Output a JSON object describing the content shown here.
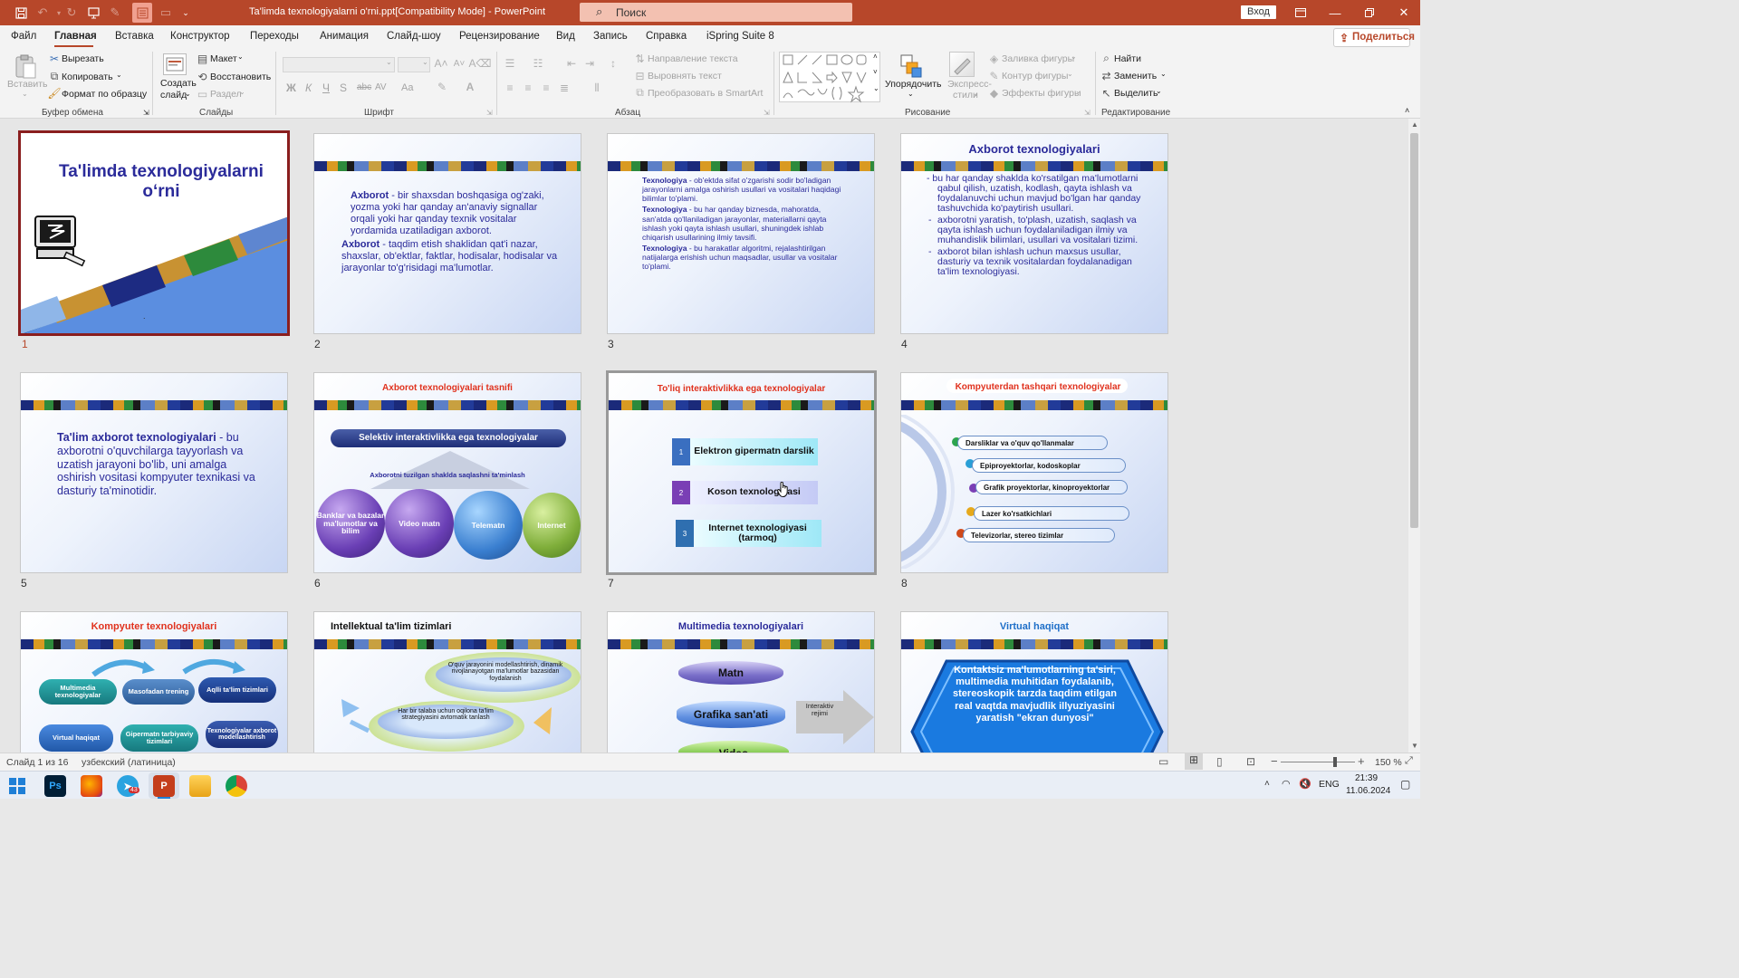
{
  "window": {
    "title": "Ta'limda texnologiyalarni o'rni.ppt[Compatibility Mode]  -  PowerPoint",
    "search_placeholder": "Поиск",
    "signin_label": "Вход"
  },
  "menu": {
    "items": [
      "Файл",
      "Главная",
      "Вставка",
      "Конструктор",
      "Переходы",
      "Анимация",
      "Слайд-шоу",
      "Рецензирование",
      "Вид",
      "Запись",
      "Справка",
      "iSpring Suite 8"
    ],
    "share_label": "Поделиться"
  },
  "ribbon": {
    "clipboard": {
      "paste": "Вставить",
      "cut": "Вырезать",
      "copy": "Копировать",
      "format_painter": "Формат по образцу",
      "group": "Буфер обмена"
    },
    "slides": {
      "new_slide_1": "Создать",
      "new_slide_2": "слайд",
      "layout": "Макет",
      "reset": "Восстановить",
      "section": "Раздел",
      "group": "Слайды"
    },
    "font": {
      "group": "Шрифт",
      "bold": "Ж",
      "italic": "К",
      "underline": "Ч",
      "strike": "S",
      "abc": "abc",
      "spacing": "AV",
      "case": "Aa"
    },
    "paragraph": {
      "text_direction": "Направление текста",
      "align_text": "Выровнять текст",
      "smartart": "Преобразовать в SmartArt",
      "group": "Абзац"
    },
    "drawing": {
      "arrange": "Упорядочить",
      "quick_styles_1": "Экспресс-",
      "quick_styles_2": "стили",
      "shape_fill": "Заливка фигуры",
      "shape_outline": "Контур фигуры",
      "shape_effects": "Эффекты фигуры",
      "group": "Рисование"
    },
    "editing": {
      "find": "Найти",
      "replace": "Заменить",
      "select": "Выделить",
      "group": "Редактирование"
    }
  },
  "slides": {
    "s1": {
      "num": "1",
      "title": "Ta'limda texnologiyalarni o‘rni",
      "dot": "."
    },
    "s2": {
      "num": "2",
      "p1_term": "Axborot",
      "p1": " - bir shaxsdan boshqasiga og'zaki, yozma yoki har qanday an'anaviy signallar orqali yoki har qanday texnik vositalar yordamida uzatiladigan axborot.",
      "p2_term": "Axborot",
      "p2": " - taqdim etish shaklidan qat'i nazar, shaxslar, ob'ektlar, faktlar, hodisalar, hodisalar va jarayonlar to'g'risidagi ma'lumotlar."
    },
    "s3": {
      "num": "3",
      "p1_term": "Texnologiya",
      "p1": " - ob'ektda sifat o'zgarishi sodir bo'ladigan jarayonlarni amalga oshirish usullari va vositalari haqidagi bilimlar to'plami.",
      "p2_term": "Texnologiya",
      "p2": " - bu har qanday biznesda, mahoratda, san'atda qo'llaniladigan jarayonlar, materiallarni qayta ishlash yoki qayta ishlash usullari, shuningdek ishlab chiqarish usullarining ilmiy tavsifi.",
      "p3_term": "Texnologiya",
      "p3": " - bu harakatlar algoritmi, rejalashtirilgan natijalarga erishish uchun maqsadlar, usullar va vositalar to'plami."
    },
    "s4": {
      "num": "4",
      "title": "Axborot texnologiyalari",
      "b1": "- bu har qanday shaklda ko'rsatilgan ma'lumotlarni qabul qilish, uzatish, kodlash, qayta ishlash va foydalanuvchi uchun mavjud bo'lgan har qanday tashuvchida ko'paytirish usullari.",
      "b2": "axborotni yaratish, to'plash, uzatish, saqlash va qayta ishlash uchun foydalaniladigan ilmiy va muhandislik bilimlari, usullari va vositalari tizimi.",
      "b3": "axborot bilan ishlash uchun maxsus usullar, dasturiy va texnik vositalardan foydalanadigan ta'lim texnologiyasi.",
      "dash": "-"
    },
    "s5": {
      "num": "5",
      "term": "Ta'lim axborot texnologiyalari",
      "text": " - bu axborotni o'quvchilarga tayyorlash va uzatish jarayoni bo'lib, uni amalga oshirish vositasi kompyuter texnikasi va dasturiy ta'minotidir."
    },
    "s6": {
      "num": "6",
      "title": "Axborot texnologiyalari tasnifi",
      "banner": "Selektiv interaktivlikka ega texnologiyalar",
      "sub": "Axborotni tuzilgan shaklda saqlashni ta'minlash",
      "balls": [
        "Banklar va bazalar ma'lumotlar va bilim",
        "Video matn",
        "Telematn",
        "Internet"
      ]
    },
    "s7": {
      "num": "7",
      "title": "To'liq interaktivlikka ega texnologiyalar",
      "items": [
        {
          "n": "1",
          "label": "Elektron gipermatn darslik"
        },
        {
          "n": "2",
          "label": "Koson texnologiyasi"
        },
        {
          "n": "3",
          "label": "Internet texnologiyasi (tarmoq)"
        }
      ]
    },
    "s8": {
      "num": "8",
      "title": "Kompyuterdan tashqari texnologiyalar",
      "items": [
        "Darsliklar va o'quv qo'llanmalar",
        "Epiproyektorlar, kodoskoplar",
        "Grafik proyektorlar, kinoproyektorlar",
        "Lazer ko'rsatkichlari",
        "Televizorlar, stereo tizimlar"
      ]
    },
    "s9": {
      "title": "Kompyuter texnologiyalari",
      "pills": [
        "Multimedia texnologiyalar",
        "Masofadan trening",
        "Aqlli ta'lim tizimlari",
        "Virtual haqiqat",
        "Gipermatn tarbiyaviy tizimlari",
        "Texnologiyalar axborot modellashtirish"
      ]
    },
    "s10": {
      "title": "Intellektual ta'lim tizimlari",
      "ring1": "O'quv jarayonini modellashtirish, dinamik rivojlanayotgan ma'lumotlar bazasidan foydalanish",
      "ring2": "Har bir talaba uchun oqilona ta'lim strategiyasini avtomatik tanlash"
    },
    "s11": {
      "title": "Multimedia texnologiyalari",
      "cyl": [
        "Matn",
        "Grafika san'ati",
        "Video"
      ],
      "arrow": "Interaktiv rejimi"
    },
    "s12": {
      "title": "Virtual haqiqat",
      "text": "Kontaktsiz ma'lumotlarning ta'siri, multimedia muhitidan foydalanib, stereoskopik tarzda taqdim etilgan real vaqtda mavjudlik illyuziyasini yaratish \"ekran dunyosi\""
    }
  },
  "status": {
    "slide_info": "Слайд 1 из 16",
    "language": "узбекский (латиница)",
    "zoom": "150 %"
  },
  "taskbar": {
    "lang": "ENG",
    "time": "21:39",
    "date": "11.06.2024",
    "badge": "43"
  },
  "colors": {
    "accent": "#b7472a",
    "title_blue": "#2b2b9a",
    "title_red": "#e0321e"
  }
}
